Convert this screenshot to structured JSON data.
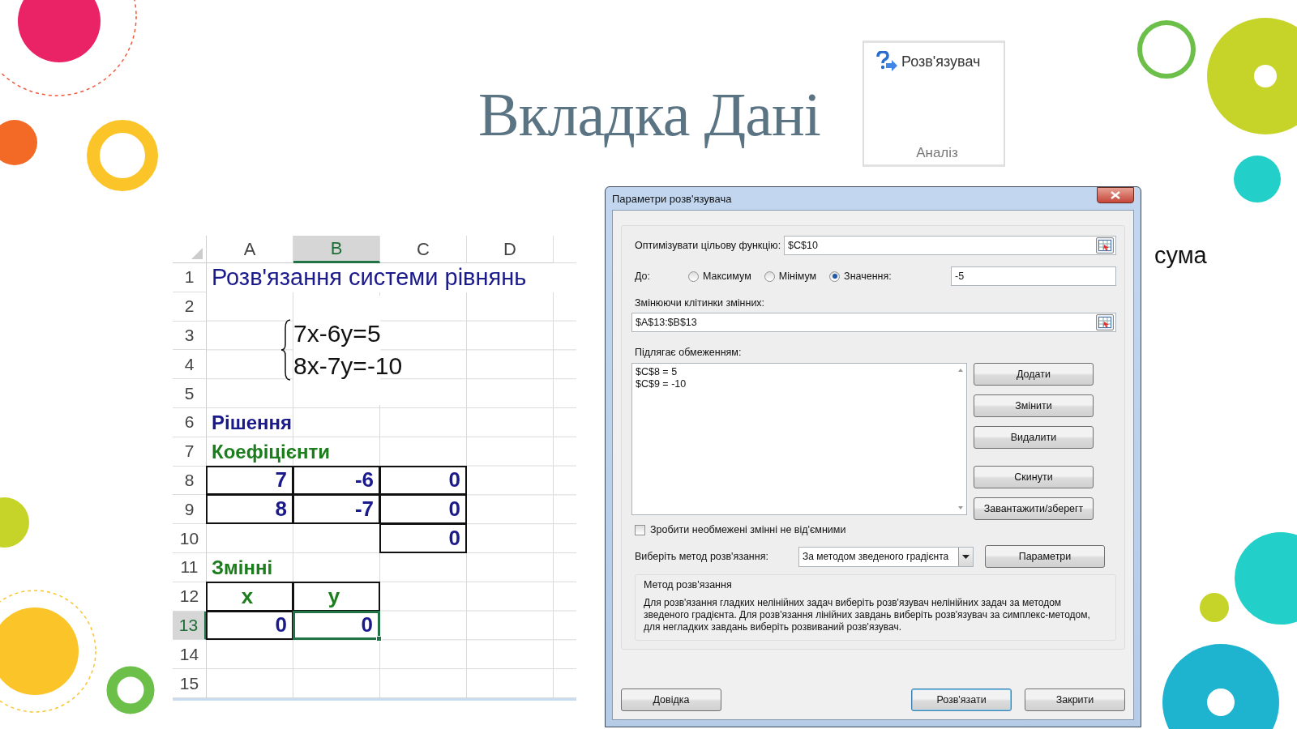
{
  "slide_title": "Вкладка Дані",
  "ribbon_group": {
    "command": "Розв'язувач",
    "group": "Аналіз"
  },
  "side_note": "сума",
  "spreadsheet": {
    "columns": [
      {
        "label": "A",
        "selected": false
      },
      {
        "label": "B",
        "selected": true
      },
      {
        "label": "C",
        "selected": false
      },
      {
        "label": "D",
        "selected": false
      }
    ],
    "rows": [
      {
        "label": "1",
        "selected": false
      },
      {
        "label": "2",
        "selected": false
      },
      {
        "label": "3",
        "selected": false
      },
      {
        "label": "4",
        "selected": false
      },
      {
        "label": "5",
        "selected": false
      },
      {
        "label": "6",
        "selected": false
      },
      {
        "label": "7",
        "selected": false
      },
      {
        "label": "8",
        "selected": false
      },
      {
        "label": "9",
        "selected": false
      },
      {
        "label": "10",
        "selected": false
      },
      {
        "label": "11",
        "selected": false
      },
      {
        "label": "12",
        "selected": false
      },
      {
        "label": "13",
        "selected": true
      },
      {
        "label": "14",
        "selected": false
      },
      {
        "label": "15",
        "selected": false
      }
    ],
    "title": "Розв'язання системи рівнянь",
    "system": [
      "7x-6y=5",
      "8x-7y=-10"
    ],
    "solution_label": "Рішення",
    "coefficients_label": "Коефіцієнти",
    "coefficients": [
      [
        "7",
        "-6",
        "0"
      ],
      [
        "8",
        "-7",
        "0"
      ]
    ],
    "total": "0",
    "variables_label": "Змінні",
    "variable_names": [
      "x",
      "y"
    ],
    "variable_values": [
      {
        "value": "0",
        "selected": false
      },
      {
        "value": "0",
        "selected": true
      }
    ]
  },
  "solver_dialog": {
    "title": "Параметри розв'язувача",
    "objective": {
      "label": "Оптимізувати цільову функцію:",
      "value": "$C$10"
    },
    "to_label": "До:",
    "targets": [
      {
        "label": "Максимум",
        "selected": false
      },
      {
        "label": "Мінімум",
        "selected": false
      },
      {
        "label": "Значення:",
        "selected": true
      }
    ],
    "target_value": "-5",
    "variables": {
      "label": "Змінюючи клітинки змінних:",
      "value": "$A$13:$B$13"
    },
    "constraints": {
      "label": "Підлягає обмеженням:",
      "items": [
        "$C$8 = 5",
        "$C$9 = -10"
      ]
    },
    "constraint_buttons": [
      "Додати",
      "Змінити",
      "Видалити",
      "Скинути",
      "Завантажити/зберегт"
    ],
    "nonnegative": {
      "label": "Зробити необмежені змінні не від'ємними",
      "checked": false
    },
    "method": {
      "label": "Виберіть метод розв'язання:",
      "value": "За методом зведеного градієнта",
      "button": "Параметри"
    },
    "method_info": {
      "title": "Метод розв'язання",
      "text": "Для розв'язання гладких нелінійних задач виберіть розв'язувач нелінійних задач за методом зведеного градієнта. Для розв'язання лінійних завдань виберіть розв'язувач за симплекс-методом, для негладких завдань виберіть розвиваний розв'язувач."
    },
    "footer_buttons": [
      {
        "label": "Довідка",
        "default": false
      },
      {
        "label": "Розв'язати",
        "default": true
      },
      {
        "label": "Закрити",
        "default": false
      }
    ]
  }
}
